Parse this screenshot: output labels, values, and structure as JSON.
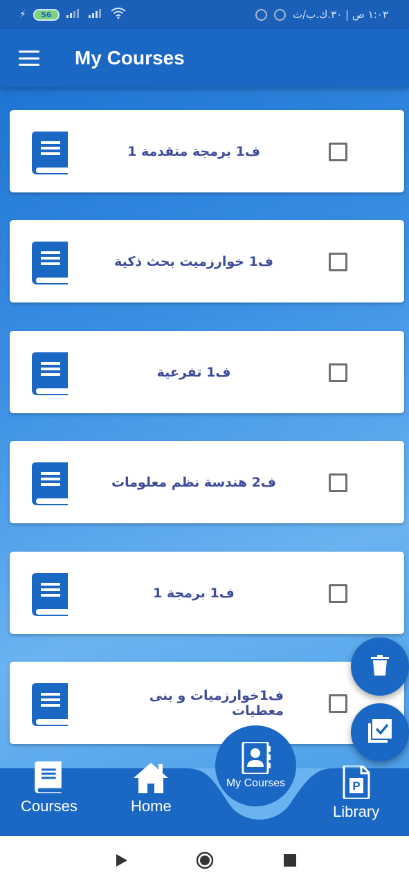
{
  "status_bar": {
    "battery": "56",
    "time_text": "١:٠٣ ص | ٣٠.ك.ب/ث"
  },
  "app_bar": {
    "title": "My Courses",
    "menu_icon": "hamburger-menu-icon"
  },
  "courses": [
    {
      "title": "ف1   برمجة متقدمة  1",
      "icon": "book-icon",
      "checked": false
    },
    {
      "title": "ف1 خوارزميت بحث  ذكية",
      "icon": "book-icon",
      "checked": false
    },
    {
      "title": "ف1   تفرعية",
      "icon": "book-icon",
      "checked": false
    },
    {
      "title": "ف2  هندسة نظم معلومات",
      "icon": "book-icon",
      "checked": false
    },
    {
      "title": "ف1     برمجة 1",
      "icon": "book-icon",
      "checked": false
    },
    {
      "title": "ف1خوارزميات و بنى معطيات",
      "icon": "book-icon",
      "checked": false
    }
  ],
  "fabs": {
    "delete_icon": "trash-icon",
    "select_all_icon": "select-all-icon"
  },
  "bottom_nav": {
    "courses": "Courses",
    "home": "Home",
    "my_courses": "My Courses",
    "library": "Library"
  },
  "colors": {
    "primary": "#1a67c4",
    "card_text": "#3e4c9a",
    "background_light": "#6ab3f0"
  }
}
